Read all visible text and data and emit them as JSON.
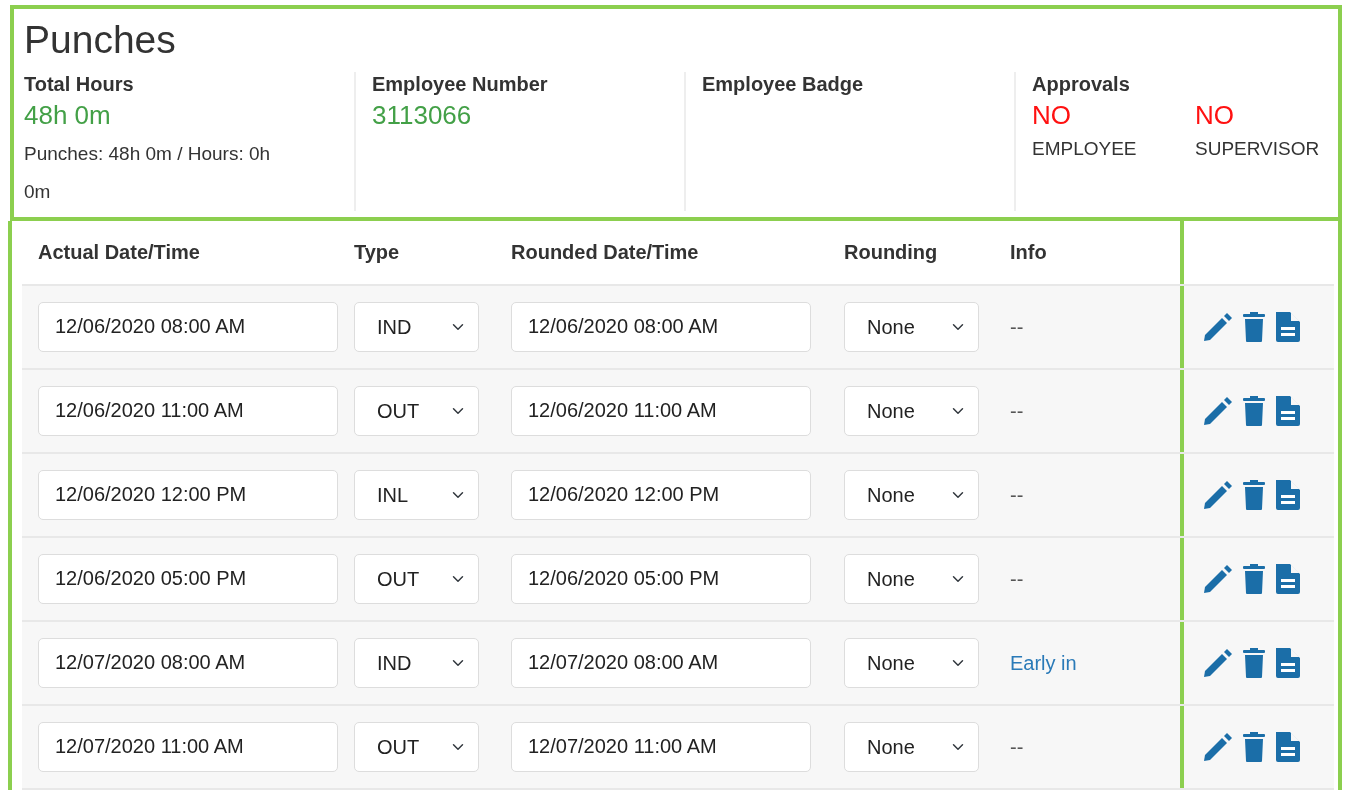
{
  "title": "Punches",
  "summary": [
    {
      "label": "Total Hours",
      "value": "48h 0m",
      "note": "Punches: 48h 0m / Hours: 0h 0m"
    },
    {
      "label": "Employee Number",
      "value": "3113066"
    },
    {
      "label": "Employee Badge"
    }
  ],
  "approvals": {
    "label": "Approvals",
    "items": [
      {
        "value": "NO",
        "approved": false,
        "role": "EMPLOYEE"
      },
      {
        "value": "NO",
        "approved": false,
        "role": "SUPERVISOR"
      }
    ]
  },
  "table": {
    "columns": [
      "Actual Date/Time",
      "Type",
      "Rounded Date/Time",
      "Rounding",
      "Info"
    ],
    "rows": [
      {
        "actual": "12/06/2020 08:00 AM",
        "type": "IND",
        "rounded": "12/06/2020 08:00 AM",
        "rounding": "None",
        "info": {
          "text": "--",
          "kind": "text"
        }
      },
      {
        "actual": "12/06/2020 11:00 AM",
        "type": "OUT",
        "rounded": "12/06/2020 11:00 AM",
        "rounding": "None",
        "info": {
          "text": "--",
          "kind": "text"
        }
      },
      {
        "actual": "12/06/2020 12:00 PM",
        "type": "INL",
        "rounded": "12/06/2020 12:00 PM",
        "rounding": "None",
        "info": {
          "text": "--",
          "kind": "text"
        }
      },
      {
        "actual": "12/06/2020 05:00 PM",
        "type": "OUT",
        "rounded": "12/06/2020 05:00 PM",
        "rounding": "None",
        "info": {
          "text": "--",
          "kind": "text"
        }
      },
      {
        "actual": "12/07/2020 08:00 AM",
        "type": "IND",
        "rounded": "12/07/2020 08:00 AM",
        "rounding": "None",
        "info": {
          "text": "Early in",
          "kind": "link"
        }
      },
      {
        "actual": "12/07/2020 11:00 AM",
        "type": "OUT",
        "rounded": "12/07/2020 11:00 AM",
        "rounding": "None",
        "info": {
          "text": "--",
          "kind": "text"
        }
      }
    ]
  }
}
